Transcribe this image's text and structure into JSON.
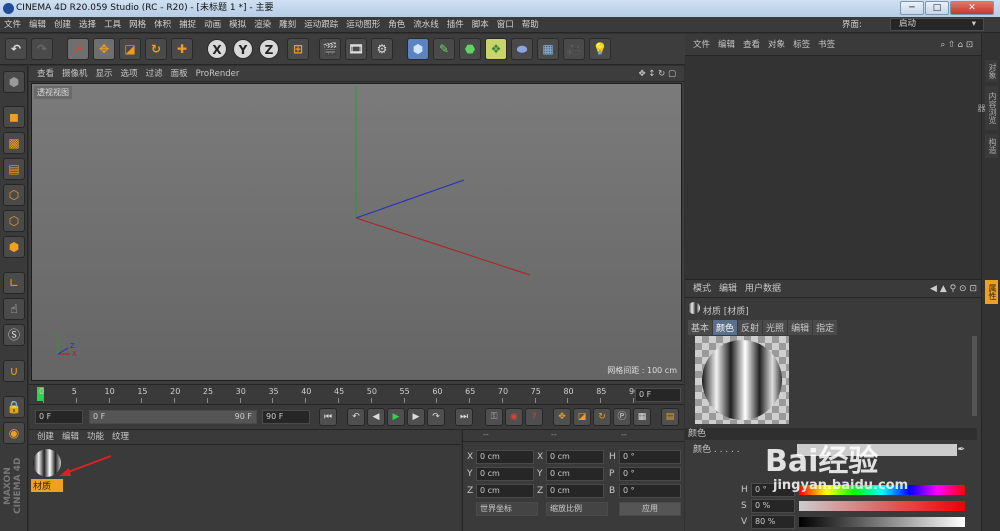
{
  "window": {
    "title": "CINEMA 4D R20.059 Studio (RC - R20) - [未标题 1 *] - 主要",
    "min": "─",
    "max": "□",
    "close": "✕"
  },
  "menubar": {
    "items": [
      "文件",
      "编辑",
      "创建",
      "选择",
      "工具",
      "网格",
      "体积",
      "捕捉",
      "动画",
      "模拟",
      "渲染",
      "雕刻",
      "运动跟踪",
      "运动图形",
      "角色",
      "流水线",
      "插件",
      "脚本",
      "窗口",
      "帮助"
    ],
    "layout_label": "界面:",
    "layout_value": "启动"
  },
  "toolbar": {
    "x": "X",
    "y": "Y",
    "z": "Z"
  },
  "viewport": {
    "menu": [
      "查看",
      "摄像机",
      "显示",
      "选项",
      "过滤",
      "面板",
      "ProRender"
    ],
    "label": "透视视图",
    "grid_info": "网格间距 : 100 cm",
    "axis_colors": {
      "x": "#b02020",
      "y": "#20a020",
      "z": "#2030c0"
    }
  },
  "timeline": {
    "ticks": [
      "0",
      "5",
      "10",
      "15",
      "20",
      "25",
      "30",
      "35",
      "40",
      "45",
      "50",
      "55",
      "60",
      "65",
      "70",
      "75",
      "80",
      "85",
      "90"
    ],
    "frame_field": "0 F"
  },
  "transport": {
    "start": "0 F",
    "range_start": "0 F",
    "range_end": "90 F",
    "end": "90 F"
  },
  "material_manager": {
    "menu": [
      "创建",
      "编辑",
      "功能",
      "纹理"
    ],
    "material_name": "材质"
  },
  "coordinates": {
    "headers": [
      "--",
      "--",
      "--"
    ],
    "rows": [
      {
        "a": "X",
        "av": "0 cm",
        "b": "X",
        "bv": "0 cm",
        "c": "H",
        "cv": "0 °"
      },
      {
        "a": "Y",
        "av": "0 cm",
        "b": "Y",
        "bv": "0 cm",
        "c": "P",
        "cv": "0 °"
      },
      {
        "a": "Z",
        "av": "0 cm",
        "b": "Z",
        "bv": "0 cm",
        "c": "B",
        "cv": "0 °"
      }
    ],
    "world_select": "世界坐标",
    "scale_select": "缩放比例",
    "apply": "应用"
  },
  "object_manager": {
    "menu": [
      "文件",
      "编辑",
      "查看",
      "对象",
      "标签",
      "书签"
    ]
  },
  "attribute_manager": {
    "menu": [
      "模式",
      "编辑",
      "用户数据"
    ],
    "title": "材质 [材质]",
    "tabs": [
      "基本",
      "颜色",
      "反射",
      "光照",
      "编辑",
      "指定"
    ],
    "section": "颜色",
    "color_label": "颜色 . . . . .",
    "h_label": "H",
    "h_value": "0 °",
    "s_label": "S",
    "s_value": "0 %",
    "v_label": "V",
    "v_value": "80 %"
  },
  "right_tabs": [
    "对象",
    "内容浏览器",
    "构造",
    "属性"
  ],
  "watermark": {
    "brand": "Bai经验",
    "url": "jingyan.baidu.com"
  },
  "maxon": {
    "line1": "MAXON",
    "line2": "CINEMA 4D"
  }
}
